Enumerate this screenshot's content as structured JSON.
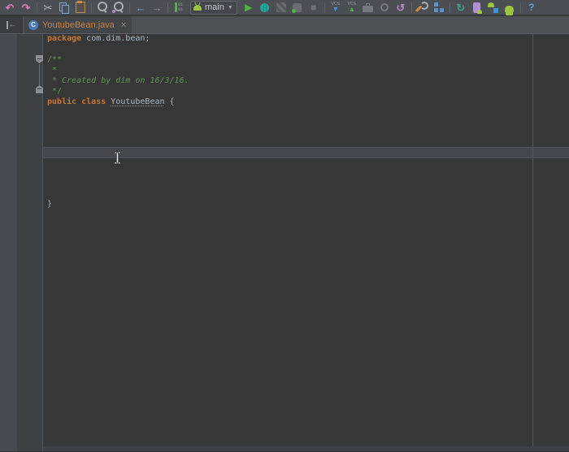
{
  "icons": {
    "undo": "↶",
    "redo": "↷",
    "cut": "✂",
    "back": "←",
    "forward": "→",
    "run": "▶",
    "stop": "■",
    "vcs": "VCS",
    "vcs_down": "▼",
    "vcs_up": "▲",
    "rollback": "↺",
    "sync": "↻",
    "help": "?",
    "hide": "←",
    "combo_caret": "▼",
    "close": "×",
    "binary_row1": "01",
    "binary_row2": "01"
  },
  "toolbar": {
    "run_config": "main"
  },
  "tabbar": {
    "tab_label": "YoutubeBean.java",
    "class_letter": "C"
  },
  "code": {
    "package_kw": "package",
    "package_rest": " com.dim.bean;",
    "doc_open": "/**",
    "doc_mid": " *",
    "doc_created": " * Created by dim on 16/3/16.",
    "doc_close": " */",
    "class_kw": "public class ",
    "class_name": "YoutubeBean",
    "class_brace": " {",
    "close_brace": "}"
  },
  "colors": {
    "keyword": "#cc7832",
    "comment": "#629755",
    "plain_text": "#a9b7c6",
    "tab_label": "#c9823e",
    "editor_bg": "#373737",
    "toolbar_bg": "#4b4f53",
    "run_green": "#4db344",
    "android_green": "#9ec43f"
  }
}
